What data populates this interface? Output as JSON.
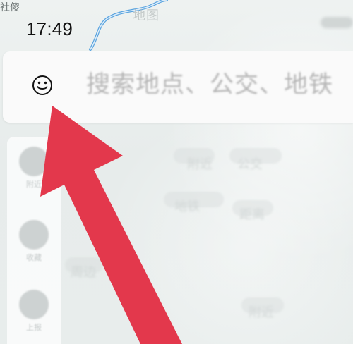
{
  "status": {
    "corner_label": "社傻",
    "time": "17:49"
  },
  "map": {
    "top_label": "地图"
  },
  "search": {
    "placeholder": "搜索地点、公交、地铁",
    "icon": "smiley-icon"
  },
  "sidebar": {
    "items": [
      {
        "label": "附近"
      },
      {
        "label": "收藏"
      },
      {
        "label": "上报"
      }
    ]
  },
  "content": {
    "lines": [
      "附近",
      "公交",
      "地铁",
      "距离",
      "周边",
      "附近"
    ]
  },
  "annotation": {
    "arrow_color": "#e3384c"
  }
}
